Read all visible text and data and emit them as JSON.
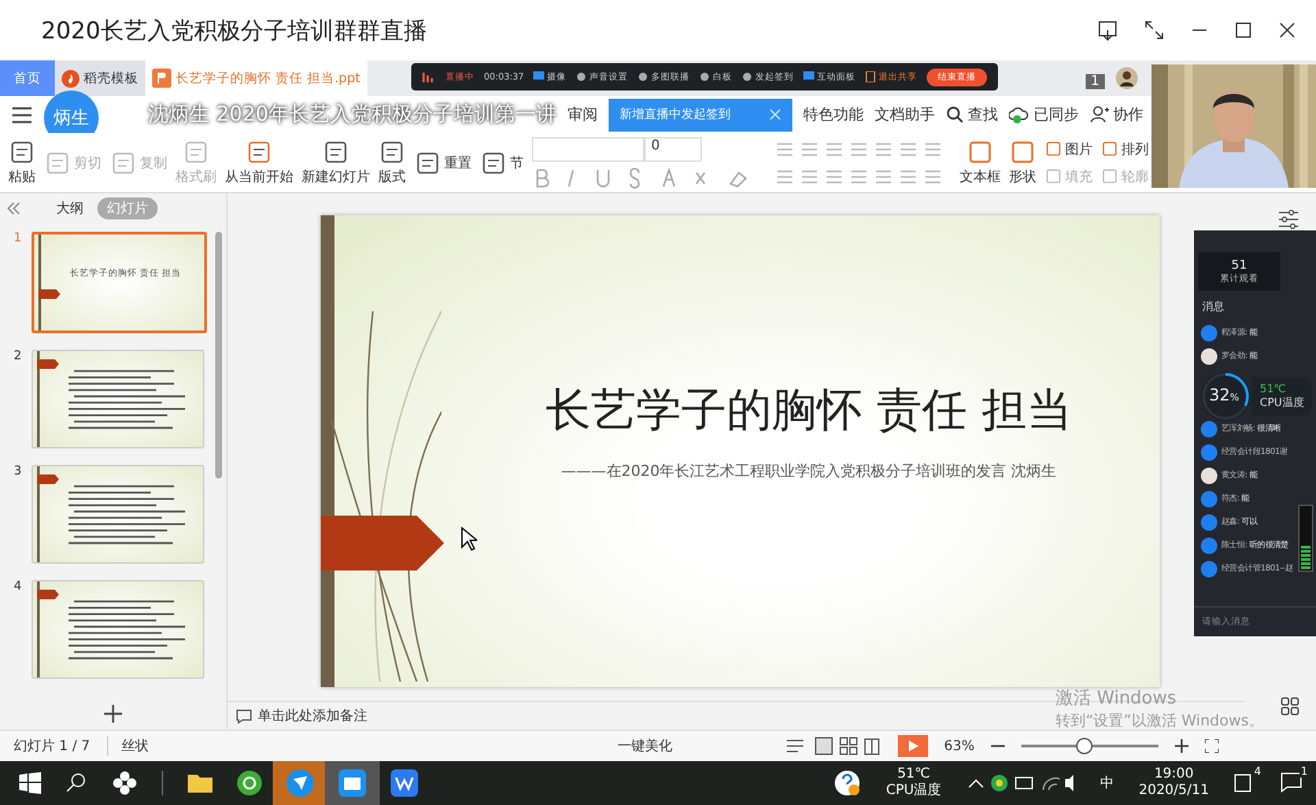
{
  "window": {
    "title": "2020长艺入党积极分子培训群群直播"
  },
  "tabs": [
    {
      "label": "首页",
      "selected": false,
      "kind": "home"
    },
    {
      "label": "稻壳模板",
      "selected": false,
      "kind": "docer"
    },
    {
      "label": "长艺学子的胸怀 责任 担当.ppt",
      "selected": true,
      "kind": "doc"
    }
  ],
  "live_toolbar": {
    "status": "直播中",
    "timer": "00:03:37",
    "items": [
      {
        "label": "摄像",
        "kind": "camera"
      },
      {
        "label": "声音设置",
        "kind": "mic"
      },
      {
        "label": "多图联播",
        "kind": "person"
      },
      {
        "label": "白板",
        "kind": "board"
      },
      {
        "label": "发起签到",
        "kind": "pin"
      },
      {
        "label": "互动面板",
        "kind": "chat"
      },
      {
        "label": "退出共享",
        "kind": "exit"
      }
    ],
    "end_button": "结束直播"
  },
  "page_count": "1",
  "stream_overlay": {
    "avatar": "炳生",
    "title": "沈炳生 2020年长艺入党积极分子培训第一讲"
  },
  "ribbon_tabs": [
    {
      "label": "审阅"
    }
  ],
  "tooltip": "新增直播中发起签到",
  "ribbon_right": [
    {
      "label": "特色功能",
      "kind": "text"
    },
    {
      "label": "文档助手",
      "kind": "text"
    },
    {
      "label": "查找",
      "kind": "search"
    },
    {
      "label": "已同步",
      "kind": "cloud"
    },
    {
      "label": "协作",
      "kind": "share"
    }
  ],
  "ribbon": [
    {
      "label": "粘贴",
      "kind": "big",
      "disabled": false
    },
    {
      "label": "剪切",
      "kind": "small",
      "disabled": true
    },
    {
      "label": "复制",
      "kind": "small",
      "disabled": true
    },
    {
      "label": "格式刷",
      "kind": "big",
      "disabled": true
    },
    {
      "label": "从当前开始",
      "kind": "big",
      "disabled": false
    },
    {
      "label": "新建幻灯片",
      "kind": "big",
      "disabled": false
    },
    {
      "label": "版式",
      "kind": "big",
      "disabled": false
    },
    {
      "label": "重置",
      "kind": "small",
      "disabled": false
    },
    {
      "label": "节",
      "kind": "small",
      "disabled": false
    }
  ],
  "font_size": "0",
  "ribbon_right_tools": [
    {
      "label": "文本框",
      "kind": "big",
      "disabled": false
    },
    {
      "label": "形状",
      "kind": "big",
      "disabled": false
    },
    {
      "label": "图片",
      "kind": "small",
      "disabled": false
    },
    {
      "label": "填充",
      "kind": "small",
      "disabled": true
    },
    {
      "label": "排列",
      "kind": "small",
      "disabled": false
    },
    {
      "label": "轮廓",
      "kind": "small",
      "disabled": true
    }
  ],
  "slides_panel": {
    "views": [
      {
        "label": "大纲",
        "selected": false
      },
      {
        "label": "幻灯片",
        "selected": true
      }
    ],
    "thumbnails": [
      {
        "number": "1",
        "selected": true,
        "kind": "title"
      },
      {
        "number": "2",
        "selected": false,
        "kind": "text"
      },
      {
        "number": "3",
        "selected": false,
        "kind": "text"
      },
      {
        "number": "4",
        "selected": false,
        "kind": "text"
      }
    ],
    "thumb_title": "长艺学子的胸怀 责任 担当"
  },
  "slide": {
    "title": "长艺学子的胸怀 责任 担当",
    "subtitle": "———在2020年长江艺术工程职业学院入党积极分子培训班的发言 沈炳生"
  },
  "notes": {
    "placeholder": "单击此处添加备注"
  },
  "chat": {
    "count": "51",
    "count_label": "累计观看",
    "heading": "消息",
    "messages": [
      {
        "name": "程泽源:",
        "text": "能"
      },
      {
        "name": "罗会劲:",
        "text": "能"
      },
      {
        "name": "艺浑刘畅:",
        "text": "很清晰"
      },
      {
        "name": "经营会计段1801谢"
      },
      {
        "name": "黄文涛:",
        "text": "能"
      },
      {
        "name": "符杰:",
        "text": "能"
      },
      {
        "name": "赵鑫:",
        "text": "可以"
      },
      {
        "name": "陈士恒:",
        "text": "听的很清楚"
      },
      {
        "name": "经营会计管1801--赵"
      }
    ],
    "placeholder": "请输入消息"
  },
  "cpu_widget": {
    "percent": "32",
    "unit": "%",
    "level": 0.32,
    "temp": "51℃",
    "label": "CPU温度"
  },
  "status_bar": {
    "counter": "幻灯片 1 / 7",
    "theme": "丝状",
    "beautify": "一键美化",
    "zoom": "63%",
    "level": 0.45
  },
  "activation": {
    "line1": "激活 Windows",
    "line2": "转到“设置”以激活 Windows。"
  },
  "taskbar": {
    "temp": "51℃",
    "label": "CPU温度",
    "ime": "中",
    "time": "19:00",
    "date": "2020/5/11",
    "badge": "4",
    "notifications": "1"
  }
}
